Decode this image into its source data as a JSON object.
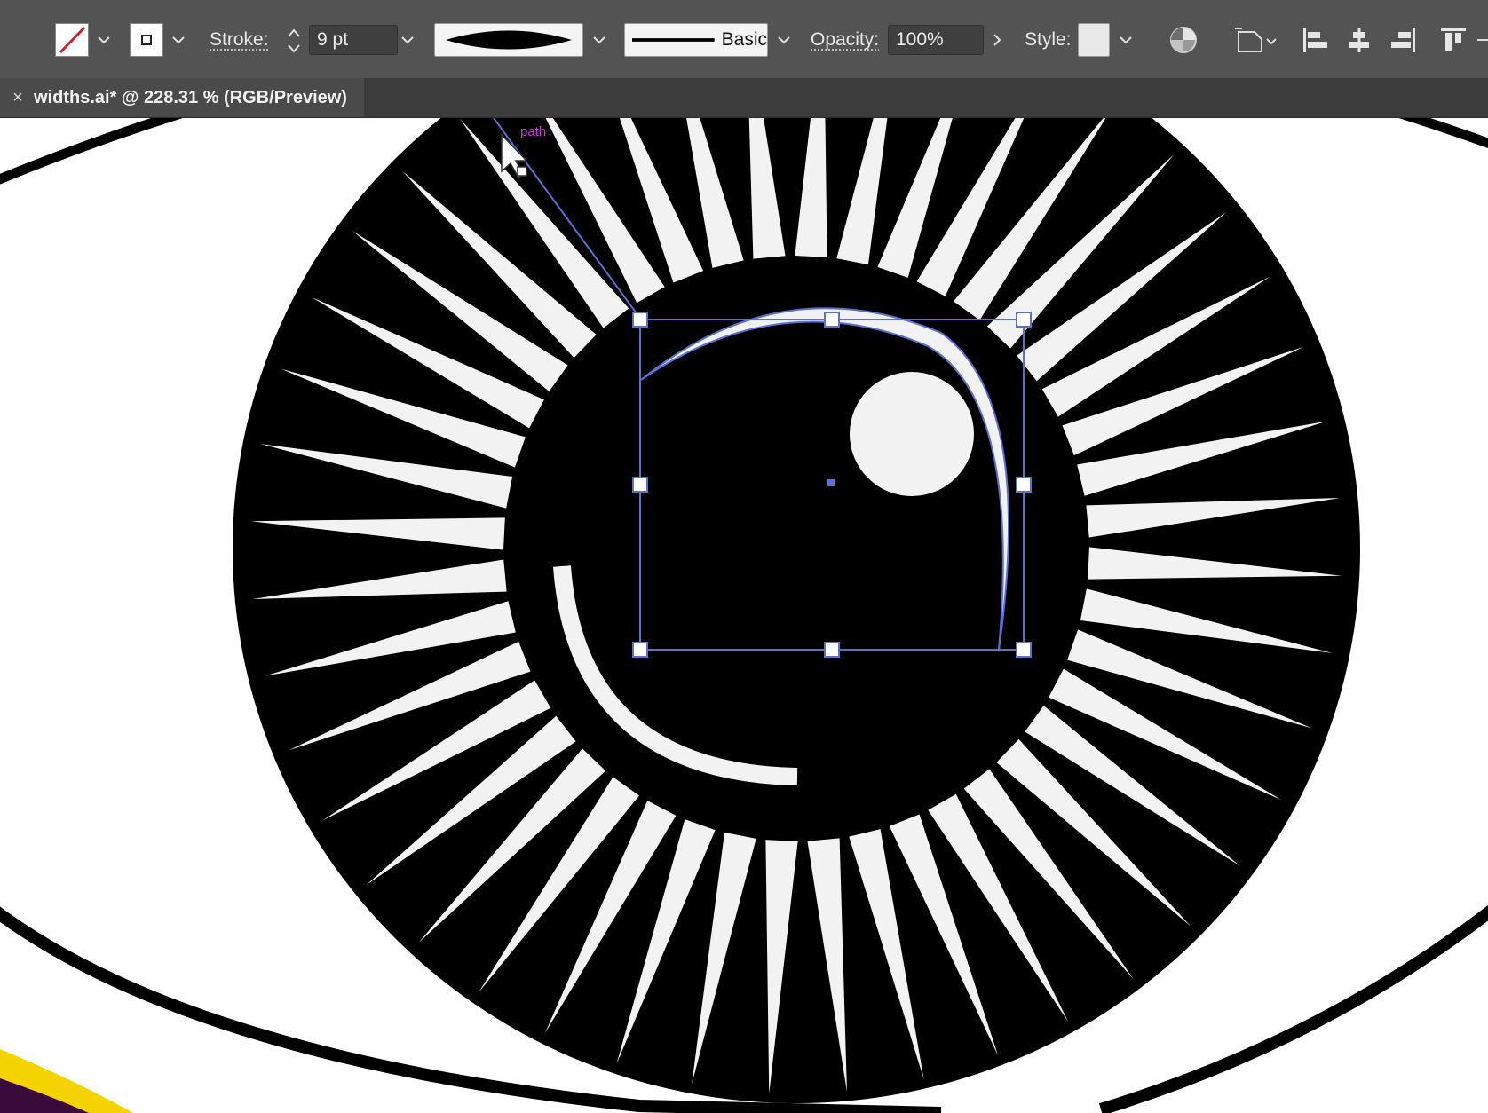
{
  "control_bar": {
    "fill_swatch": "none",
    "stroke_label": "Stroke:",
    "stroke_weight": "9 pt",
    "variable_width_profile": "width-profile-lens",
    "brush_label": "Basic",
    "opacity_label": "Opacity:",
    "opacity_value": "100%",
    "style_label": "Style:",
    "icons": [
      "none-fill-swatch-icon",
      "stroke-swatch-icon",
      "recolor-artwork-icon",
      "transform-icon",
      "align-left-icon",
      "align-horizontal-center-icon",
      "align-right-icon",
      "align-top-icon"
    ]
  },
  "document_tab": {
    "close_glyph": "×",
    "title": "widths.ai* @ 228.31 % (RGB/Preview)"
  },
  "canvas": {
    "hover_label": "path",
    "colors": {
      "artwork_black": "#000000",
      "ray_white": "#f2f2f2",
      "selection_blue": "#5b6fd6",
      "smart_guide_magenta": "#c83cdc",
      "border_yellow": "#f5d300",
      "border_purple": "#3a0a3a"
    }
  }
}
